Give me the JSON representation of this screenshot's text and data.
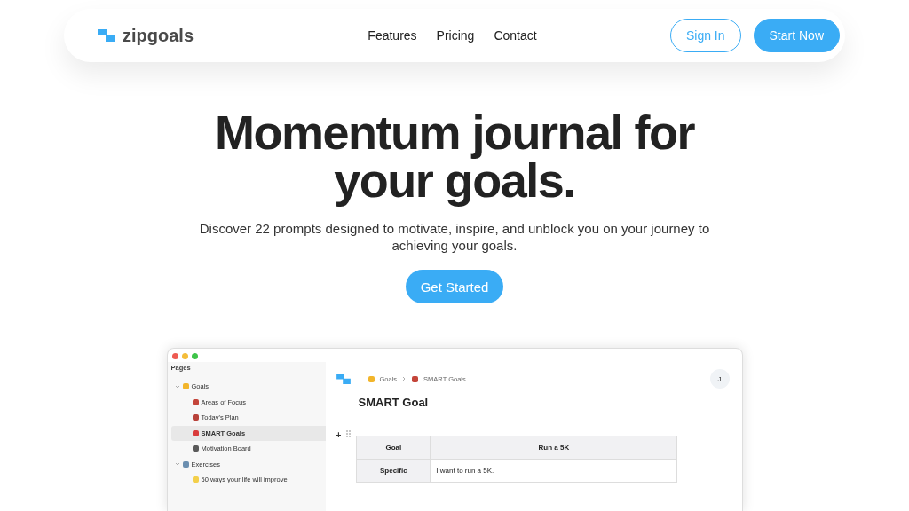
{
  "nav": {
    "logo": "zipgoals",
    "links": [
      "Features",
      "Pricing",
      "Contact"
    ],
    "sign_in": "Sign In",
    "start_now": "Start Now"
  },
  "hero": {
    "title_lines": [
      "Momentum journal for",
      "your goals."
    ],
    "subtitle": "Discover 22 prompts designed to motivate, inspire, and unblock you on your journey to achieving your goals.",
    "cta": "Get Started"
  },
  "app": {
    "sidebar": {
      "heading": "Pages",
      "items": [
        {
          "label": "Goals",
          "expanded": true,
          "selected": false,
          "children": [
            {
              "label": "Areas of Focus",
              "selected": false
            },
            {
              "label": "Today's Plan",
              "selected": false
            },
            {
              "label": "SMART Goals",
              "selected": true
            },
            {
              "label": "Motivation Board",
              "selected": false
            }
          ]
        },
        {
          "label": "Exercises",
          "expanded": true,
          "selected": false,
          "children": [
            {
              "label": "50 ways your life will improve",
              "selected": false
            }
          ]
        }
      ]
    },
    "breadcrumb": [
      "Goals",
      "SMART Goals"
    ],
    "avatar": "J",
    "page_title": "SMART Goal",
    "add_button": "+",
    "table": {
      "rows": [
        [
          "Goal",
          "Run a 5K"
        ],
        [
          "Specific",
          "I want to run a 5K."
        ]
      ]
    }
  }
}
